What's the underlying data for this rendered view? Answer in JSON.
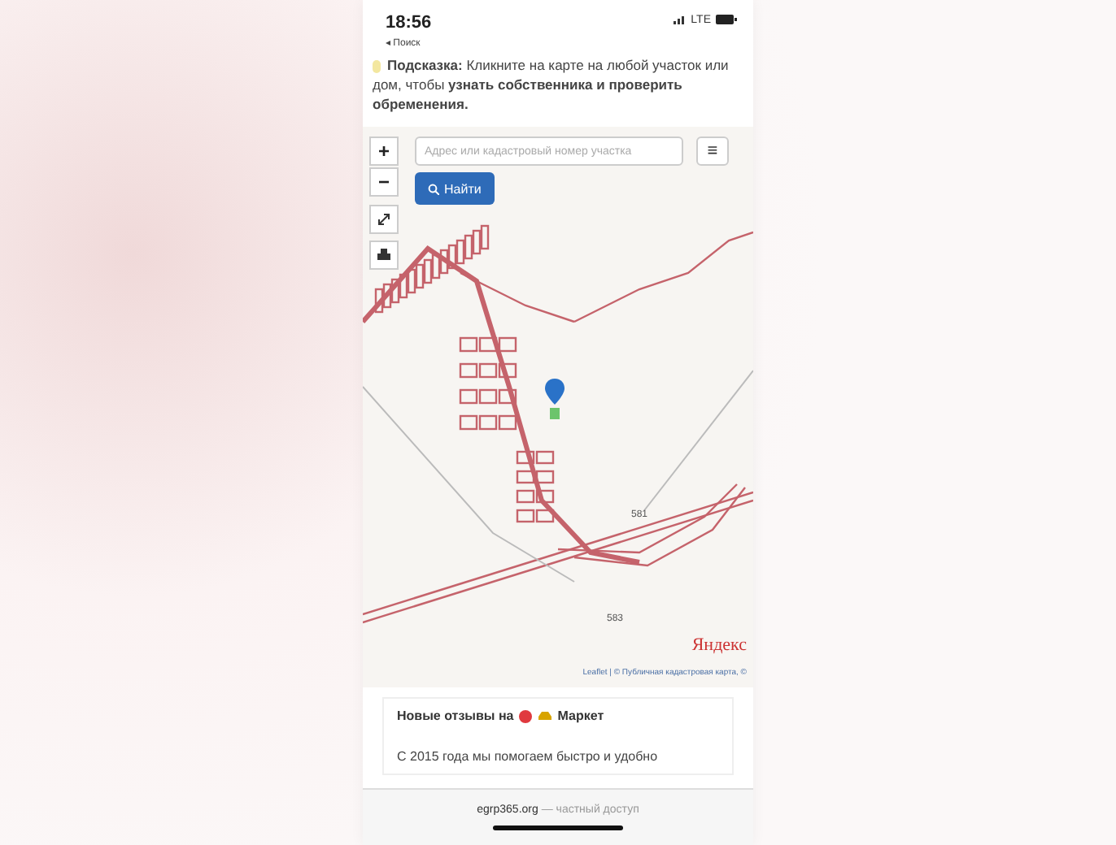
{
  "status_bar": {
    "time": "18:56",
    "back": "◂ Поиск",
    "network": "LTE"
  },
  "hint": "**Подсказка:** Кликните на карте на любой участок или дом, чтобы **узнать собственника и проверить обременения.**",
  "map": {
    "zoom_in": "+",
    "zoom_out": "−",
    "search": {
      "placeholder": "Адрес или кадастровый номер участка"
    },
    "find_button": "Найти",
    "menu": "≡",
    "labels": [
      "581",
      "583"
    ],
    "provider": "Яндекс",
    "attribution": "Leaflet | © Публичная кадастровая карта, ©"
  },
  "reviews": {
    "title_start": "Новые отзывы на",
    "title_end": "Маркет",
    "text": "С 2015 года мы помогаем быстро и удобно"
  },
  "address_bar": {
    "domain": "egrp365.org",
    "suffix": "— частный доступ"
  }
}
